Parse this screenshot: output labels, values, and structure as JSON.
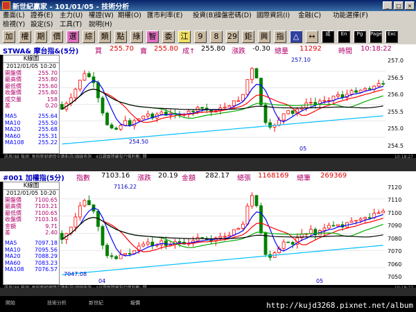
{
  "window": {
    "title": "新世紀贏家 - 101/01/05 - 技術分析",
    "minimize": "_",
    "maximize": "□",
    "close": "×"
  },
  "menu": {
    "row1": [
      "畫面(L)",
      "證券(E)",
      "主力(U)",
      "權證(W)",
      "期權(O)",
      "匯市利率(E)",
      "投資(B)",
      "操盤密碼(D)",
      "國際資訊(I)",
      "金融(C)",
      "功能選擇(F)"
    ],
    "row2": [
      "檢視(Y)",
      "設定(S)",
      "工具(T)",
      "說明(H)"
    ]
  },
  "toolbar": [
    "加",
    "權",
    "期",
    "價",
    "選",
    "綜",
    "類",
    "點",
    "綠",
    "智",
    "委",
    "江",
    "9",
    "8",
    "29",
    "鉅",
    "興",
    "指",
    "△",
    "↔",
    "成",
    "En",
    "Pg",
    "Page",
    "Exc"
  ],
  "panel1": {
    "symbol": "STWA& 摩台指&(5分)",
    "buy_label": "買",
    "buy": "255.70",
    "sell_label": "賣",
    "sell": "255.80",
    "deal_label": "成↑",
    "deal": "255.80",
    "change_label": "漲跌",
    "change": "-0.30",
    "volume_label": "總量",
    "volume": "11292",
    "time_label": "時間",
    "time": "10:18:22",
    "info": {
      "title": "K線圖",
      "date": "2012/01/05 10:20",
      "rows": [
        {
          "l": "開盤價",
          "v": "255.70"
        },
        {
          "l": "最高價",
          "v": "255.80"
        },
        {
          "l": "最低價",
          "v": "255.60"
        },
        {
          "l": "收盤價",
          "v": "255.80"
        },
        {
          "l": "成交量",
          "v": "158"
        },
        {
          "l": "差",
          "v": "0.20"
        }
      ],
      "ma": [
        {
          "l": "MA5",
          "v": "255.64"
        },
        {
          "l": "MA10",
          "v": "255.50"
        },
        {
          "l": "MA20",
          "v": "255.68"
        },
        {
          "l": "MA60",
          "v": "255.31"
        },
        {
          "l": "MA108",
          "v": "255.22"
        }
      ]
    },
    "yticks": [
      "257.0",
      "256.5",
      "256.0",
      "255.5",
      "255.0",
      "254.5"
    ],
    "ann_high": "257.10",
    "ann_low": "254.50",
    "xlabel": "05",
    "status_left": "訊息(88 檢測: 盈科新組網資中路對訊(綿線查詢 · 4日課面隱藏投行盤利數: 開",
    "status_right": "10:18:27"
  },
  "panel2": {
    "symbol": "#001 加權指(5分)",
    "index_label": "指數",
    "index": "7103.16",
    "change_label": "漲跌",
    "change": "20.19",
    "amount_label": "金額",
    "amount": "282.17",
    "volume_label": "總張",
    "volume": "1168169",
    "total_label": "總筆",
    "total": "269369",
    "info": {
      "title": "K線圖",
      "date": "2012/01/05 10:20",
      "rows": [
        {
          "l": "開盤價",
          "v": "7100.65"
        },
        {
          "l": "最高價",
          "v": "7103.21"
        },
        {
          "l": "最低價",
          "v": "7100.65"
        },
        {
          "l": "收盤價",
          "v": "7103.16"
        },
        {
          "l": "金額",
          "v": "9.71"
        },
        {
          "l": "差",
          "v": "2.40"
        }
      ],
      "ma": [
        {
          "l": "MA5",
          "v": "7097.18"
        },
        {
          "l": "MA10",
          "v": "7095.56"
        },
        {
          "l": "MA20",
          "v": "7088.29"
        },
        {
          "l": "MA60",
          "v": "7083.23"
        },
        {
          "l": "MA108",
          "v": "7076.57"
        }
      ]
    },
    "yticks": [
      "7120",
      "7110",
      "7100",
      "7090",
      "7080",
      "7070",
      "7060",
      "7050"
    ],
    "ann_high": "7116.22",
    "ann_low": "7047.08",
    "xlabel1": "04",
    "xlabel2": "05",
    "status_left": "訊息(88 檢測: 盈科新組網資中路對訊(綿線查詢 · 4日課面隱藏投行盤利數: 開",
    "status_right": "10:18:27"
  },
  "taskbar": [
    "開始",
    "技術分析",
    "新世紀",
    "報價"
  ],
  "watermark": "http://kujd3268.pixnet.net/album",
  "colors": {
    "up": "#ff0000",
    "down": "#008000",
    "ma5": "#0000ff",
    "ma10": "#ff0000",
    "ma20": "#00aa00",
    "ma60": "#000000",
    "ma108": "#00bfff"
  }
}
